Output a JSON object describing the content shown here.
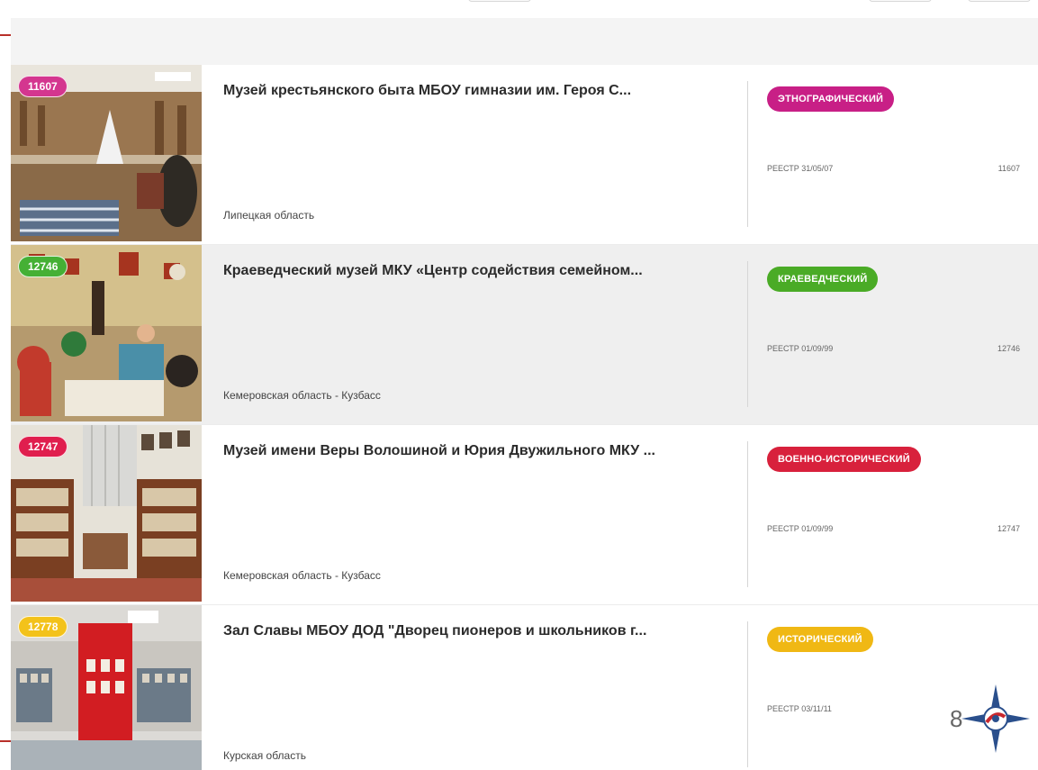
{
  "cards": [
    {
      "id_badge": "11607",
      "badge_color": "#d4368f",
      "title": "Музей крестьянского быта МБОУ гимназии им. Героя С...",
      "region": "Липецкая область",
      "type": "ЭТНОГРАФИЧЕСКИЙ",
      "type_color": "#c81f86",
      "registry": "РЕЕСТР 31/05/07",
      "number": "11607"
    },
    {
      "id_badge": "12746",
      "badge_color": "#45b035",
      "title": "Краеведческий музей МКУ «Центр содействия семейном...",
      "region": "Кемеровская область - Кузбасс",
      "type": "КРАЕВЕДЧЕСКИЙ",
      "type_color": "#4aab26",
      "registry": "РЕЕСТР 01/09/99",
      "number": "12746"
    },
    {
      "id_badge": "12747",
      "badge_color": "#e01e4e",
      "title": "Музей имени Веры Волошиной и Юрия Двужильного МКУ ...",
      "region": "Кемеровская область - Кузбасс",
      "type": "ВОЕННО-ИСТОРИЧЕСКИЙ",
      "type_color": "#d8213c",
      "registry": "РЕЕСТР 01/09/99",
      "number": "12747"
    },
    {
      "id_badge": "12778",
      "badge_color": "#f3c21a",
      "title": "Зал Славы МБОУ ДОД \"Дворец пионеров и школьников г...",
      "region": "Курская область",
      "type": "ИСТОРИЧЕСКИЙ",
      "type_color": "#f0b814",
      "registry": "РЕЕСТР 03/11/11",
      "number": ""
    }
  ],
  "page_number": "8",
  "colors": {
    "accent_line": "#b8302a",
    "list_bg": "#f4f4f4"
  },
  "icons": {
    "logo": "compass-rose-logo-icon"
  }
}
